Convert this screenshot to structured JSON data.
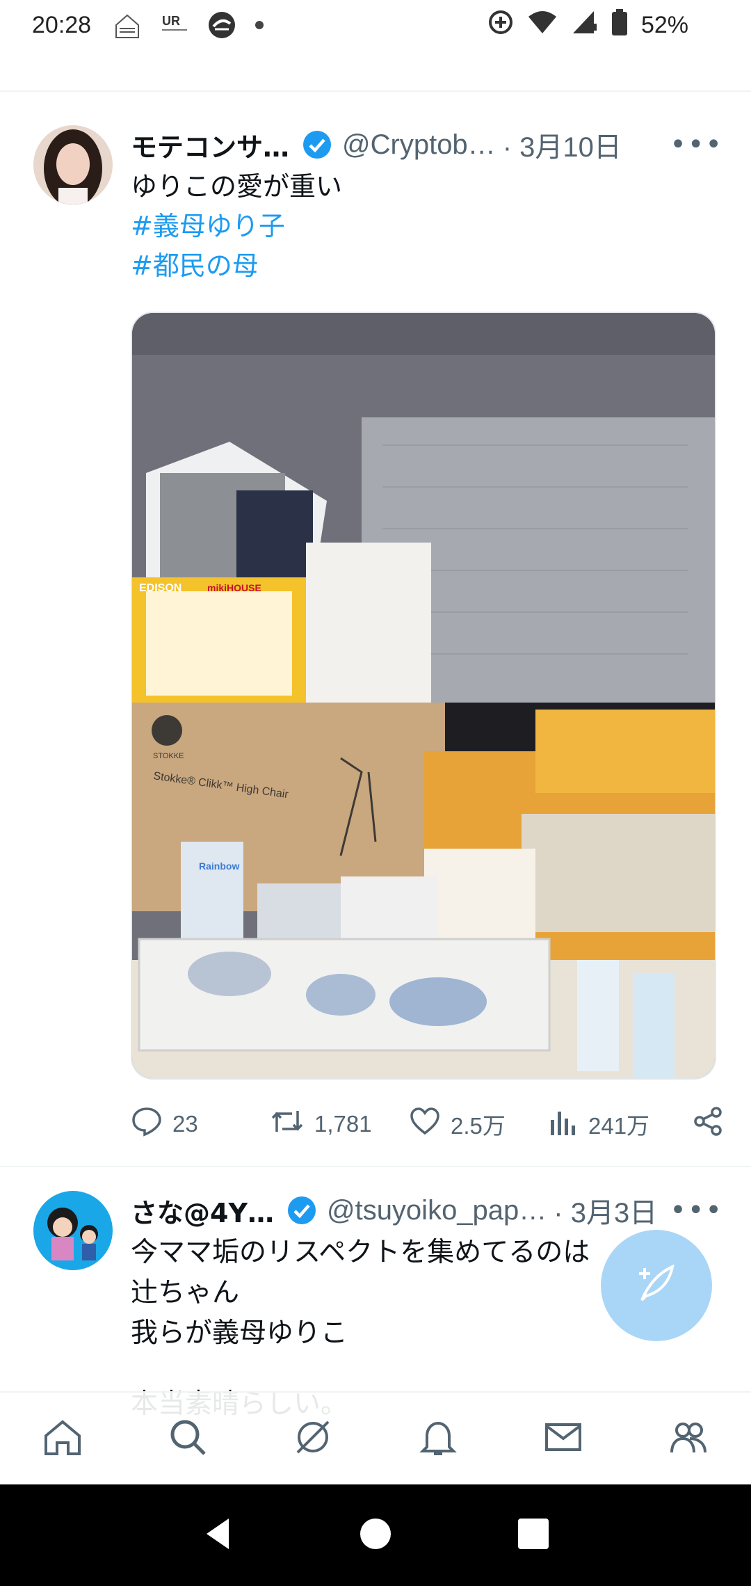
{
  "status_bar": {
    "time": "20:28",
    "battery_percent": "52%",
    "app_icons": [
      "home-icon",
      "ur-icon",
      "vpn-icon",
      "dot-icon"
    ],
    "right_icons": [
      "data-saver-icon",
      "wifi-icon",
      "signal-icon",
      "battery-icon"
    ],
    "mini_logos": {
      "ur": "UR"
    }
  },
  "tweets": [
    {
      "name": "モテコンサ…",
      "handle": "@Cryptob…",
      "date": "· 3月10日",
      "more": "•••",
      "verified": true,
      "text": "ゆりこの愛が重い",
      "hashtags": [
        "#義母ゆり子",
        "#都民の母"
      ],
      "media": {
        "product_labels": [
          "EDISON",
          "mikiHOUSE",
          "STOKKE",
          "Stokke® Clikk™ High Chair",
          "Rainbow"
        ]
      },
      "stats": {
        "replies": "23",
        "retweets": "1,781",
        "likes": "2.5万",
        "views": "241万"
      }
    },
    {
      "name": "さな@4Y…",
      "handle": "@tsuyoiko_pap…",
      "date": "· 3月3日",
      "more": "•••",
      "verified": true,
      "lines": [
        "今ママ垢のリスペクトを集めてるのは",
        "辻ちゃん",
        "我らが義母ゆりこ",
        "本当素晴らしい。"
      ]
    }
  ],
  "colors": {
    "accent": "#1d9bf0",
    "text": "#0f1419",
    "secondary": "#536471",
    "fab": "#a9d6f7"
  },
  "bottom_nav": [
    "home-icon",
    "search-icon",
    "spaces-icon",
    "notifications-icon",
    "messages-icon",
    "communities-icon"
  ]
}
